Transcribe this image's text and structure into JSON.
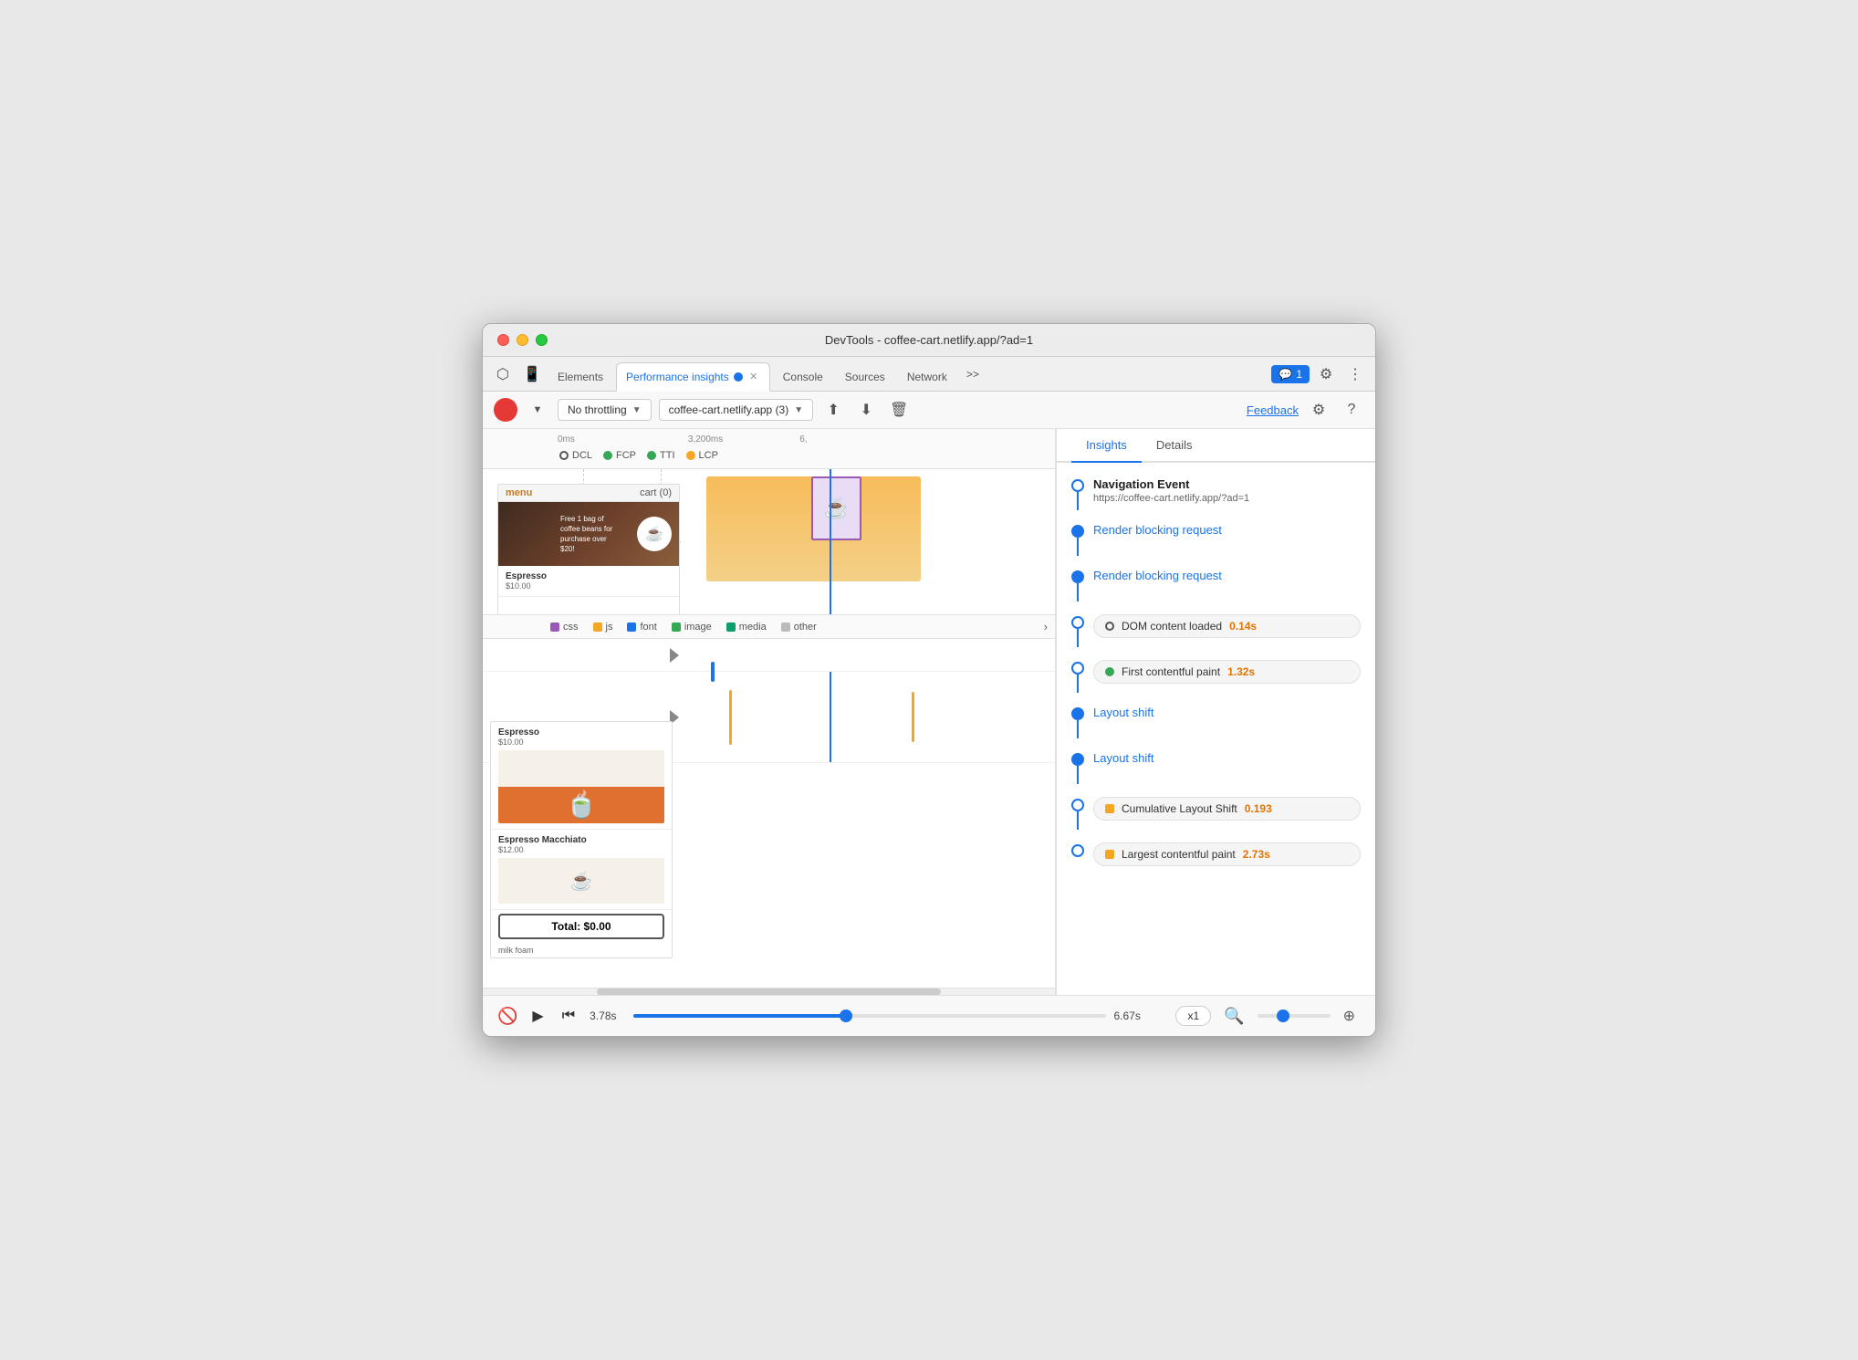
{
  "window": {
    "title": "DevTools - coffee-cart.netlify.app/?ad=1"
  },
  "tabs": [
    {
      "id": "elements",
      "label": "Elements",
      "active": false
    },
    {
      "id": "performance-insights",
      "label": "Performance insights",
      "active": true,
      "pinned": true,
      "closeable": true
    },
    {
      "id": "console",
      "label": "Console",
      "active": false
    },
    {
      "id": "sources",
      "label": "Sources",
      "active": false
    },
    {
      "id": "network",
      "label": "Network",
      "active": false
    }
  ],
  "toolbar": {
    "throttling": "No throttling",
    "url": "coffee-cart.netlify.app (3)",
    "feedback_label": "Feedback"
  },
  "timeline": {
    "timestamps": [
      "0ms",
      "3,200ms",
      "6,"
    ],
    "markers": [
      "DCL",
      "FCP",
      "TTI",
      "LCP"
    ],
    "legend": [
      "css",
      "js",
      "font",
      "image",
      "media",
      "other"
    ]
  },
  "insights_tabs": [
    {
      "id": "insights",
      "label": "Insights",
      "active": true
    },
    {
      "id": "details",
      "label": "Details",
      "active": false
    }
  ],
  "insights": {
    "navigation_event": {
      "title": "Navigation Event",
      "url": "https://coffee-cart.netlify.app/?ad=1"
    },
    "items": [
      {
        "id": "render-blocking-1",
        "type": "link",
        "label": "Render blocking request"
      },
      {
        "id": "render-blocking-2",
        "type": "link",
        "label": "Render blocking request"
      },
      {
        "id": "dom-loaded",
        "type": "badge",
        "label": "DOM content loaded",
        "value": "0.14s",
        "badge_type": "circle"
      },
      {
        "id": "fcp",
        "type": "badge",
        "label": "First contentful paint",
        "value": "1.32s",
        "badge_type": "green-dot"
      },
      {
        "id": "layout-shift-1",
        "type": "link",
        "label": "Layout shift"
      },
      {
        "id": "layout-shift-2",
        "type": "link",
        "label": "Layout shift"
      },
      {
        "id": "cls",
        "type": "badge",
        "label": "Cumulative Layout Shift",
        "value": "0.193",
        "badge_type": "orange-square"
      },
      {
        "id": "lcp",
        "type": "badge",
        "label": "Largest contentful paint",
        "value": "2.73s",
        "badge_type": "orange-square"
      }
    ]
  },
  "bottombar": {
    "time_start": "3.78s",
    "time_end": "6.67s",
    "zoom_level": "x1"
  },
  "page_preview": {
    "header_left": "menu",
    "header_right": "cart (0)",
    "hero_text": "Free 1 bag of coffee beans for purchase over $20!",
    "products": [
      {
        "name": "Espresso",
        "price": "$10.00"
      },
      {
        "name": "Espresso Macchiato",
        "price": "$12.00"
      }
    ],
    "total": "Total: $0.00",
    "more_text": "milk foam"
  }
}
